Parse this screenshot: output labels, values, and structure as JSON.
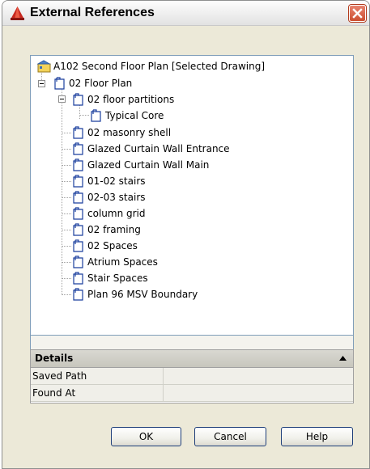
{
  "window": {
    "title": "External References",
    "close_icon": "close-icon"
  },
  "tree": {
    "root": {
      "label": "A102 Second Floor Plan [Selected Drawing]",
      "icon": "drawing-root-icon"
    },
    "floor_plan": {
      "label": "02 Floor Plan",
      "icon": "xref-drawing-icon"
    },
    "partitions": {
      "label": "02 floor partitions",
      "icon": "xref-drawing-icon"
    },
    "typical_core": {
      "label": "Typical Core",
      "icon": "xref-drawing-icon"
    },
    "items": [
      {
        "label": "02 masonry shell"
      },
      {
        "label": "Glazed Curtain Wall Entrance"
      },
      {
        "label": "Glazed Curtain Wall Main"
      },
      {
        "label": "01-02 stairs"
      },
      {
        "label": "02-03 stairs"
      },
      {
        "label": "column grid"
      },
      {
        "label": "02 framing"
      },
      {
        "label": "02 Spaces"
      },
      {
        "label": "Atrium Spaces"
      },
      {
        "label": "Stair Spaces"
      },
      {
        "label": "Plan 96 MSV Boundary"
      }
    ]
  },
  "details": {
    "title": "Details",
    "rows": [
      {
        "name": "Saved Path",
        "value": ""
      },
      {
        "name": "Found At",
        "value": ""
      }
    ]
  },
  "buttons": {
    "ok": "OK",
    "cancel": "Cancel",
    "help": "Help"
  },
  "colors": {
    "dialog_bg": "#ece9d8",
    "close_red": "#cc4f31",
    "border_blue": "#7f9db9"
  }
}
